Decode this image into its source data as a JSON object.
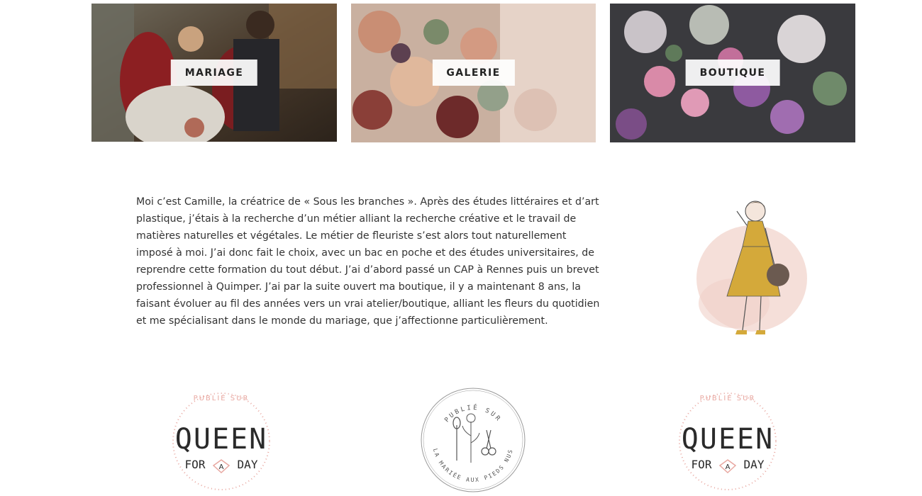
{
  "cards": [
    {
      "label": "MARIAGE"
    },
    {
      "label": "GALERIE"
    },
    {
      "label": "BOUTIQUE"
    }
  ],
  "bio": {
    "text": "Moi c’est Camille, la créatrice de « Sous les branches ». Après des études littéraires et d’art plastique, j’étais à la recherche d’un métier alliant la recherche créative et le travail de matières naturelles et végétales. Le métier de fleuriste s’est alors tout naturellement imposé à moi. J’ai donc fait le choix, avec un bac en poche et des études universitaires, de reprendre cette formation du tout début. J’ai d’abord passé un CAP à Rennes puis un brevet professionnel à Quimper.  J’ai par la suite ouvert ma boutique, il y a maintenant 8 ans, la faisant évoluer au fil des années vers un vrai atelier/boutique, alliant les fleurs du quotidien et me spécialisant dans le monde du mariage, que j’affectionne particulièrement."
  },
  "badges": [
    {
      "top_text": "PUBLIÉ SUR",
      "main": "QUEEN",
      "left_word": "FOR",
      "mid_letter": "A",
      "right_word": "DAY"
    },
    {
      "top_text": "PUBLIÉ SUR",
      "bottom_text": "LA MARIÉE AUX PIEDS NUS"
    },
    {
      "top_text": "PUBLIÉ SUR",
      "main": "QUEEN",
      "left_word": "FOR",
      "mid_letter": "A",
      "right_word": "DAY"
    }
  ],
  "colors": {
    "badge_pink": "#e8a7a0",
    "badge_ink": "#2a2a2a",
    "dress_mustard": "#d4a93a",
    "blush": "#f3d9d2"
  },
  "icons": [
    "wedding-couple-photo",
    "bouquet-photo",
    "purple-bouquet-photo",
    "florist-illustration",
    "queen-for-a-day-badge",
    "mariee-aux-pieds-nus-badge"
  ]
}
